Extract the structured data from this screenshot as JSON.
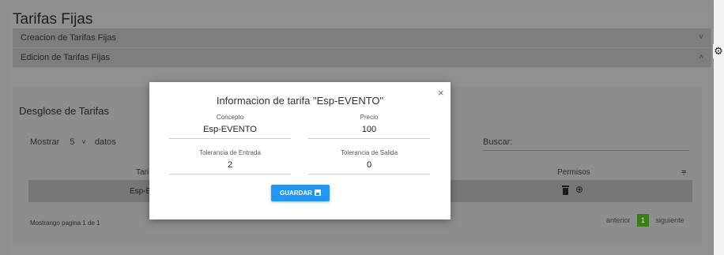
{
  "page": {
    "title": "Tarifas Fijas",
    "accordions": [
      {
        "label": "Creacion de Tarifas Fijas",
        "chevron": "˅"
      },
      {
        "label": "Edicion de Tarifas Fijas",
        "chevron": "˄"
      }
    ],
    "settings_icon": "⚙"
  },
  "table_card": {
    "title": "Desglose de Tarifas",
    "show_label": "Mostrar",
    "page_size": "5",
    "page_size_chevron": "˅",
    "datos_label": "datos",
    "search_label": "Buscar:",
    "columns": {
      "col1": "Tari",
      "col2": "Permisos",
      "sort_icon": "⩦"
    },
    "rows": [
      {
        "col1": "Esp-E"
      }
    ],
    "zoom_icon": "⊕",
    "footer_info": "Mostrango pagina 1 de 1",
    "pager": {
      "prev": "anterior",
      "current": "1",
      "next": "siguiente"
    }
  },
  "modal": {
    "title": "Informacion de tarifa \"Esp-EVENTO\"",
    "close": "×",
    "fields": [
      {
        "label": "Concepto",
        "value": "Esp-EVENTO"
      },
      {
        "label": "Precio",
        "value": "100"
      },
      {
        "label": "Tolerancia de Entrada",
        "value": "2"
      },
      {
        "label": "Tolerancia de Salida",
        "value": "0"
      }
    ],
    "save_label": "GUARDAR"
  },
  "colors": {
    "primary": "#2196f3",
    "pager_active": "#3b7a1d"
  }
}
